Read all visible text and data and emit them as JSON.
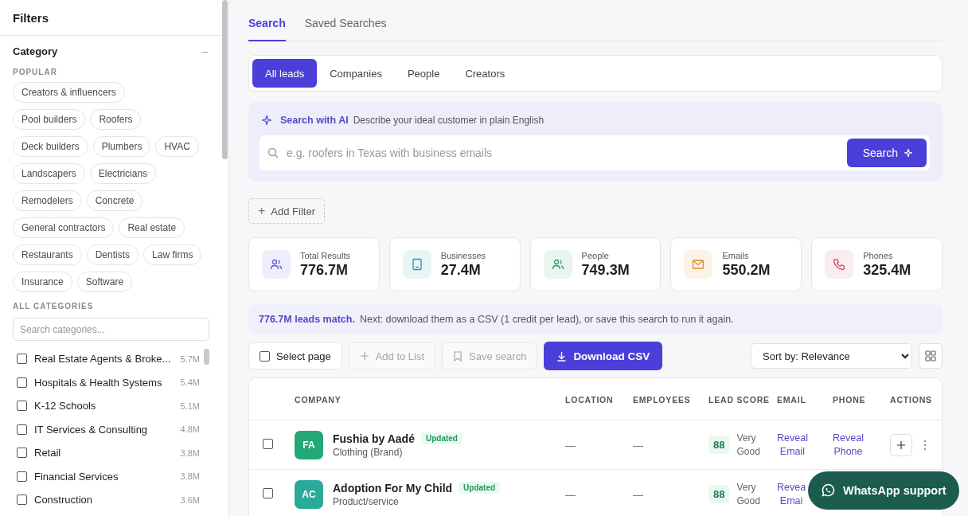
{
  "sidebar": {
    "title": "Filters",
    "section": {
      "title": "Category",
      "toggle": "–",
      "popular_label": "POPULAR",
      "popular": [
        [
          "Creators & influencers"
        ],
        [
          "Pool builders",
          "Roofers"
        ],
        [
          "Deck builders",
          "Plumbers",
          "HVAC"
        ],
        [
          "Landscapers",
          "Electricians"
        ],
        [
          "Remodelers",
          "Concrete"
        ],
        [
          "General contractors",
          "Real estate"
        ],
        [
          "Restaurants",
          "Dentists",
          "Law firms"
        ],
        [
          "Insurance",
          "Software"
        ]
      ],
      "all_label": "ALL CATEGORIES",
      "search": {
        "placeholder": "Search categories..."
      },
      "categories": [
        {
          "name": "Real Estate Agents & Broke...",
          "count": "5.7M",
          "checked": false
        },
        {
          "name": "Hospitals & Health Systems",
          "count": "5.4M",
          "checked": false
        },
        {
          "name": "K-12 Schools",
          "count": "5.1M",
          "checked": false
        },
        {
          "name": "IT Services & Consulting",
          "count": "4.8M",
          "checked": false
        },
        {
          "name": "Retail",
          "count": "3.8M",
          "checked": false
        },
        {
          "name": "Financial Services",
          "count": "3.8M",
          "checked": false
        },
        {
          "name": "Construction",
          "count": "3.6M",
          "checked": false
        }
      ]
    }
  },
  "tabs": [
    {
      "label": "Search",
      "selected": true
    },
    {
      "label": "Saved Searches",
      "selected": false
    }
  ],
  "lead_types": [
    {
      "label": "All leads",
      "selected": true
    },
    {
      "label": "Companies",
      "selected": false
    },
    {
      "label": "People",
      "selected": false
    },
    {
      "label": "Creators",
      "selected": false
    }
  ],
  "ai_search": {
    "title": "Search with AI",
    "subtitle": "Describe your ideal customer in plain English",
    "placeholder": "e.g. roofers in Texas with business emails",
    "button": "Search"
  },
  "add_filter": {
    "icon": "+",
    "label": "Add Filter"
  },
  "stats": [
    {
      "label": "Total Results",
      "value": "776.7M",
      "kind": "users",
      "color": "#5b5bd6"
    },
    {
      "label": "Businesses",
      "value": "27.4M",
      "kind": "building",
      "color": "#2a8fb0"
    },
    {
      "label": "People",
      "value": "749.3M",
      "kind": "users",
      "color": "#2f9e6a"
    },
    {
      "label": "Emails",
      "value": "550.2M",
      "kind": "mail",
      "color": "#e08a1e"
    },
    {
      "label": "Phones",
      "value": "325.4M",
      "kind": "phone",
      "color": "#d4445c"
    }
  ],
  "banner": {
    "highlight": "776.7M leads match.",
    "text": "Next: download them as a CSV (1 credit per lead), or save this search to run it again."
  },
  "toolbar": {
    "select_page": {
      "label": "Select page",
      "checked": false
    },
    "add_to_list": {
      "label": "Add to List",
      "disabled": true
    },
    "save_search": {
      "label": "Save search",
      "disabled": true
    },
    "download": "Download CSV",
    "sort": "Sort by: Relevance"
  },
  "table": {
    "columns": [
      "COMPANY",
      "LOCATION",
      "EMPLOYEES",
      "LEAD SCORE",
      "EMAIL",
      "PHONE",
      "ACTIONS"
    ],
    "rows": [
      {
        "checked": false,
        "initials": "FA",
        "color": "#24a876",
        "name": "Fushia by Aadé",
        "badge": "Updated",
        "type": "Clothing (Brand)",
        "location": "—",
        "employees": "—",
        "score": "88",
        "rating": "Very Good",
        "email": [
          "Reveal",
          "Email"
        ],
        "phone": [
          "Reveal",
          "Phone"
        ],
        "actions": true
      },
      {
        "checked": false,
        "initials": "AC",
        "color": "#2aaa98",
        "name": "Adoption For My Child",
        "badge": "Updated",
        "type": "Product/service",
        "location": "—",
        "employees": "—",
        "score": "88",
        "rating": "Very Good",
        "email": [
          "Revea",
          "Emai"
        ]
      }
    ]
  },
  "support": {
    "label": "WhatsApp support"
  }
}
